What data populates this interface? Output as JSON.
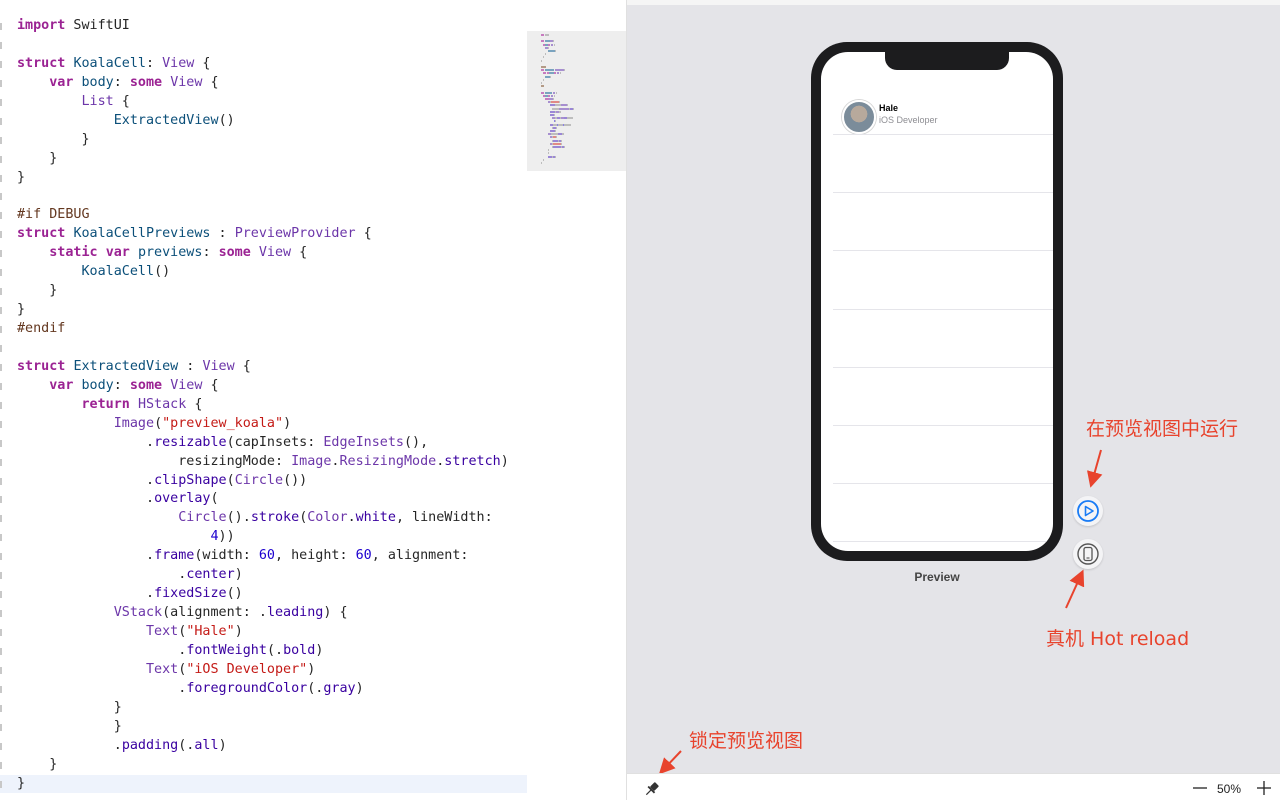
{
  "editor": {
    "lines": [
      [
        [
          "kw",
          "import"
        ],
        [
          "pl",
          " SwiftUI"
        ]
      ],
      [],
      [
        [
          "kw",
          "struct"
        ],
        [
          "pl",
          " "
        ],
        [
          "ty",
          "KoalaCell"
        ],
        [
          "pl",
          ": "
        ],
        [
          "tp",
          "View"
        ],
        [
          "pl",
          " {"
        ]
      ],
      [
        [
          "pl",
          "    "
        ],
        [
          "kw",
          "var"
        ],
        [
          "pl",
          " "
        ],
        [
          "ty",
          "body"
        ],
        [
          "pl",
          ": "
        ],
        [
          "kw",
          "some"
        ],
        [
          "pl",
          " "
        ],
        [
          "tp",
          "View"
        ],
        [
          "pl",
          " {"
        ]
      ],
      [
        [
          "pl",
          "        "
        ],
        [
          "tp",
          "List"
        ],
        [
          "pl",
          " {"
        ]
      ],
      [
        [
          "pl",
          "            "
        ],
        [
          "ty",
          "ExtractedView"
        ],
        [
          "pl",
          "()"
        ]
      ],
      [
        [
          "pl",
          "        }"
        ]
      ],
      [
        [
          "pl",
          "    }"
        ]
      ],
      [
        [
          "pl",
          "}"
        ]
      ],
      [],
      [
        [
          "pp",
          "#if DEBUG"
        ]
      ],
      [
        [
          "kw",
          "struct"
        ],
        [
          "pl",
          " "
        ],
        [
          "ty",
          "KoalaCellPreviews"
        ],
        [
          "pl",
          " : "
        ],
        [
          "tp",
          "PreviewProvider"
        ],
        [
          "pl",
          " {"
        ]
      ],
      [
        [
          "pl",
          "    "
        ],
        [
          "kw",
          "static"
        ],
        [
          "pl",
          " "
        ],
        [
          "kw",
          "var"
        ],
        [
          "pl",
          " "
        ],
        [
          "ty",
          "previews"
        ],
        [
          "pl",
          ": "
        ],
        [
          "kw",
          "some"
        ],
        [
          "pl",
          " "
        ],
        [
          "tp",
          "View"
        ],
        [
          "pl",
          " {"
        ]
      ],
      [
        [
          "pl",
          "        "
        ],
        [
          "ty",
          "KoalaCell"
        ],
        [
          "pl",
          "()"
        ]
      ],
      [
        [
          "pl",
          "    }"
        ]
      ],
      [
        [
          "pl",
          "}"
        ]
      ],
      [
        [
          "pp",
          "#endif"
        ]
      ],
      [],
      [
        [
          "kw",
          "struct"
        ],
        [
          "pl",
          " "
        ],
        [
          "ty",
          "ExtractedView"
        ],
        [
          "pl",
          " : "
        ],
        [
          "tp",
          "View"
        ],
        [
          "pl",
          " {"
        ]
      ],
      [
        [
          "pl",
          "    "
        ],
        [
          "kw",
          "var"
        ],
        [
          "pl",
          " "
        ],
        [
          "ty",
          "body"
        ],
        [
          "pl",
          ": "
        ],
        [
          "kw",
          "some"
        ],
        [
          "pl",
          " "
        ],
        [
          "tp",
          "View"
        ],
        [
          "pl",
          " {"
        ]
      ],
      [
        [
          "pl",
          "        "
        ],
        [
          "kw",
          "return"
        ],
        [
          "pl",
          " "
        ],
        [
          "tp",
          "HStack"
        ],
        [
          "pl",
          " {"
        ]
      ],
      [
        [
          "pl",
          "            "
        ],
        [
          "tp",
          "Image"
        ],
        [
          "pl",
          "("
        ],
        [
          "st",
          "\"preview_koala\""
        ],
        [
          "pl",
          ")"
        ]
      ],
      [
        [
          "pl",
          "                ."
        ],
        [
          "fn",
          "resizable"
        ],
        [
          "pl",
          "(capInsets: "
        ],
        [
          "tp",
          "EdgeInsets"
        ],
        [
          "pl",
          "(),"
        ]
      ],
      [
        [
          "pl",
          "                    resizingMode: "
        ],
        [
          "tp",
          "Image"
        ],
        [
          "pl",
          "."
        ],
        [
          "tp",
          "ResizingMode"
        ],
        [
          "pl",
          "."
        ],
        [
          "fn",
          "stretch"
        ],
        [
          "pl",
          ")"
        ]
      ],
      [
        [
          "pl",
          "                ."
        ],
        [
          "fn",
          "clipShape"
        ],
        [
          "pl",
          "("
        ],
        [
          "tp",
          "Circle"
        ],
        [
          "pl",
          "())"
        ]
      ],
      [
        [
          "pl",
          "                ."
        ],
        [
          "fn",
          "overlay"
        ],
        [
          "pl",
          "("
        ]
      ],
      [
        [
          "pl",
          "                    "
        ],
        [
          "tp",
          "Circle"
        ],
        [
          "pl",
          "()."
        ],
        [
          "fn",
          "stroke"
        ],
        [
          "pl",
          "("
        ],
        [
          "tp",
          "Color"
        ],
        [
          "pl",
          "."
        ],
        [
          "fn",
          "white"
        ],
        [
          "pl",
          ", lineWidth:"
        ]
      ],
      [
        [
          "pl",
          "                        "
        ],
        [
          "nm",
          "4"
        ],
        [
          "pl",
          "))"
        ]
      ],
      [
        [
          "pl",
          "                ."
        ],
        [
          "fn",
          "frame"
        ],
        [
          "pl",
          "(width: "
        ],
        [
          "nm",
          "60"
        ],
        [
          "pl",
          ", height: "
        ],
        [
          "nm",
          "60"
        ],
        [
          "pl",
          ", alignment:"
        ]
      ],
      [
        [
          "pl",
          "                    ."
        ],
        [
          "fn",
          "center"
        ],
        [
          "pl",
          ")"
        ]
      ],
      [
        [
          "pl",
          "                ."
        ],
        [
          "fn",
          "fixedSize"
        ],
        [
          "pl",
          "()"
        ]
      ],
      [
        [
          "pl",
          "            "
        ],
        [
          "tp",
          "VStack"
        ],
        [
          "pl",
          "(alignment: ."
        ],
        [
          "fn",
          "leading"
        ],
        [
          "pl",
          ") {"
        ]
      ],
      [
        [
          "pl",
          "                "
        ],
        [
          "tp",
          "Text"
        ],
        [
          "pl",
          "("
        ],
        [
          "st",
          "\"Hale\""
        ],
        [
          "pl",
          ")"
        ]
      ],
      [
        [
          "pl",
          "                    ."
        ],
        [
          "fn",
          "fontWeight"
        ],
        [
          "pl",
          "(."
        ],
        [
          "fn",
          "bold"
        ],
        [
          "pl",
          ")"
        ]
      ],
      [
        [
          "pl",
          "                "
        ],
        [
          "tp",
          "Text"
        ],
        [
          "pl",
          "("
        ],
        [
          "st",
          "\"iOS Developer\""
        ],
        [
          "pl",
          ")"
        ]
      ],
      [
        [
          "pl",
          "                    ."
        ],
        [
          "fn",
          "foregroundColor"
        ],
        [
          "pl",
          "(."
        ],
        [
          "fn",
          "gray"
        ],
        [
          "pl",
          ")"
        ]
      ],
      [
        [
          "pl",
          "            }"
        ]
      ],
      [
        [
          "pl",
          "            }"
        ]
      ],
      [
        [
          "pl",
          "            ."
        ],
        [
          "fn",
          "padding"
        ],
        [
          "pl",
          "(."
        ],
        [
          "fn",
          "all"
        ],
        [
          "pl",
          ")"
        ]
      ],
      [
        [
          "pl",
          "    }"
        ]
      ],
      [
        [
          "pl",
          "}"
        ]
      ]
    ],
    "current_line": 40
  },
  "preview": {
    "cell_name": "Hale",
    "cell_role": "iOS Developer",
    "label": "Preview"
  },
  "annotations": {
    "live": "在预览视图中运行",
    "device": "真机 Hot reload",
    "pin": "锁定预览视图"
  },
  "toolbar": {
    "zoom_level": "50%"
  },
  "icons": {
    "live": "play-circle-icon",
    "device": "device-icon",
    "pin": "pin-icon",
    "zoom_out": "minus-icon",
    "zoom_in": "plus-icon"
  },
  "colors": {
    "accent": "#1a7cf5",
    "annotation": "#e8432d",
    "canvas": "#e4e4e8"
  }
}
